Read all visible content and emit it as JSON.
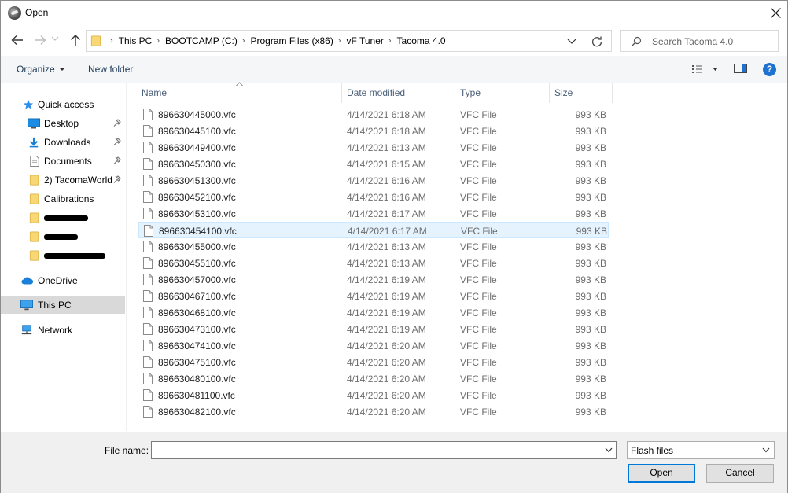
{
  "window": {
    "title": "Open"
  },
  "address": {
    "crumbs": [
      "This PC",
      "BOOTCAMP (C:)",
      "Program Files (x86)",
      "vF Tuner",
      "Tacoma 4.0"
    ]
  },
  "search": {
    "placeholder": "Search Tacoma 4.0"
  },
  "toolbar": {
    "organize_label": "Organize",
    "new_folder_label": "New folder",
    "help_label": "?"
  },
  "nav": {
    "quick_access": "Quick access",
    "items": [
      {
        "label": "Desktop",
        "icon": "desktop-icon",
        "pinned": true
      },
      {
        "label": "Downloads",
        "icon": "downloads-icon",
        "pinned": true
      },
      {
        "label": "Documents",
        "icon": "documents-icon",
        "pinned": true
      },
      {
        "label": "2) TacomaWorld",
        "icon": "folder-icon",
        "pinned": true
      },
      {
        "label": "Calibrations",
        "icon": "folder-icon",
        "pinned": false
      }
    ],
    "onedrive": "OneDrive",
    "this_pc": "This PC",
    "network": "Network"
  },
  "columns": {
    "name": "Name",
    "date": "Date modified",
    "type": "Type",
    "size": "Size"
  },
  "files": [
    {
      "name": "896630445000.vfc",
      "date": "4/14/2021 6:18 AM",
      "type": "VFC File",
      "size": "993 KB"
    },
    {
      "name": "896630445100.vfc",
      "date": "4/14/2021 6:18 AM",
      "type": "VFC File",
      "size": "993 KB"
    },
    {
      "name": "896630449400.vfc",
      "date": "4/14/2021 6:13 AM",
      "type": "VFC File",
      "size": "993 KB"
    },
    {
      "name": "896630450300.vfc",
      "date": "4/14/2021 6:15 AM",
      "type": "VFC File",
      "size": "993 KB"
    },
    {
      "name": "896630451300.vfc",
      "date": "4/14/2021 6:16 AM",
      "type": "VFC File",
      "size": "993 KB"
    },
    {
      "name": "896630452100.vfc",
      "date": "4/14/2021 6:16 AM",
      "type": "VFC File",
      "size": "993 KB"
    },
    {
      "name": "896630453100.vfc",
      "date": "4/14/2021 6:17 AM",
      "type": "VFC File",
      "size": "993 KB"
    },
    {
      "name": "896630454100.vfc",
      "date": "4/14/2021 6:17 AM",
      "type": "VFC File",
      "size": "993 KB"
    },
    {
      "name": "896630455000.vfc",
      "date": "4/14/2021 6:13 AM",
      "type": "VFC File",
      "size": "993 KB"
    },
    {
      "name": "896630455100.vfc",
      "date": "4/14/2021 6:13 AM",
      "type": "VFC File",
      "size": "993 KB"
    },
    {
      "name": "896630457000.vfc",
      "date": "4/14/2021 6:19 AM",
      "type": "VFC File",
      "size": "993 KB"
    },
    {
      "name": "896630467100.vfc",
      "date": "4/14/2021 6:19 AM",
      "type": "VFC File",
      "size": "993 KB"
    },
    {
      "name": "896630468100.vfc",
      "date": "4/14/2021 6:19 AM",
      "type": "VFC File",
      "size": "993 KB"
    },
    {
      "name": "896630473100.vfc",
      "date": "4/14/2021 6:19 AM",
      "type": "VFC File",
      "size": "993 KB"
    },
    {
      "name": "896630474100.vfc",
      "date": "4/14/2021 6:20 AM",
      "type": "VFC File",
      "size": "993 KB"
    },
    {
      "name": "896630475100.vfc",
      "date": "4/14/2021 6:20 AM",
      "type": "VFC File",
      "size": "993 KB"
    },
    {
      "name": "896630480100.vfc",
      "date": "4/14/2021 6:20 AM",
      "type": "VFC File",
      "size": "993 KB"
    },
    {
      "name": "896630481100.vfc",
      "date": "4/14/2021 6:20 AM",
      "type": "VFC File",
      "size": "993 KB"
    },
    {
      "name": "896630482100.vfc",
      "date": "4/14/2021 6:20 AM",
      "type": "VFC File",
      "size": "993 KB"
    }
  ],
  "hovered_file_index": 7,
  "footer": {
    "file_name_label": "File name:",
    "file_name_value": "",
    "filter": "Flash files",
    "open_label": "Open",
    "cancel_label": "Cancel"
  },
  "colors": {
    "accent": "#0078d7",
    "folder": "#f8d775",
    "hover_row": "#e5f3ff",
    "selected_nav": "#d9d9d9"
  }
}
